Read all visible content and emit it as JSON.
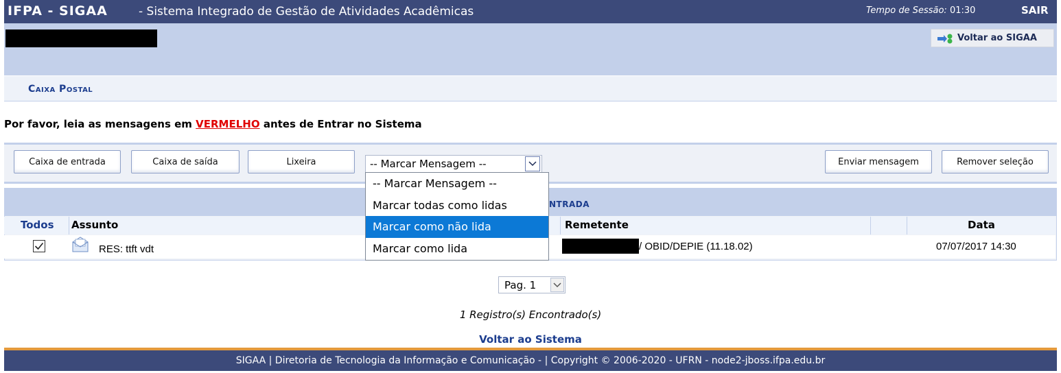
{
  "header": {
    "brand": "IFPA - SIGAA",
    "system_title": "- Sistema Integrado de Gestão de Atividades Acadêmicas",
    "session_label": "Tempo de Sessão:",
    "session_time": "01:30",
    "logout": "SAIR"
  },
  "user_bar": {
    "back_label": "Voltar ao SIGAA"
  },
  "page": {
    "title": "Caixa Postal",
    "warning_before": "Por favor, leia as mensagens em ",
    "warning_red": "VERMELHO",
    "warning_after": " antes de Entrar no Sistema"
  },
  "toolbar": {
    "inbox": "Caixa de entrada",
    "outbox": "Caixa de saída",
    "trash": "Lixeira",
    "mark_select_value": "-- Marcar Mensagem --",
    "send": "Enviar mensagem",
    "remove": "Remover seleção"
  },
  "mark_dropdown": {
    "options": [
      "-- Marcar Mensagem --",
      "Marcar todas como lidas",
      "Marcar como não lida",
      "Marcar como lida"
    ],
    "highlighted_index": 2
  },
  "table": {
    "caption_visible": "NTRADA",
    "headers": {
      "all": "Todos",
      "subject": "Assunto",
      "sender": "Remetente",
      "date": "Data"
    },
    "rows": [
      {
        "checked": true,
        "subject": "RES: ttft vdt",
        "sender_suffix": "/ OBID/DEPIE (11.18.02)",
        "date": "07/07/2017 14:30"
      }
    ]
  },
  "pagination": {
    "value": "Pag. 1"
  },
  "records": "1 Registro(s) Encontrado(s)",
  "back_system": "Voltar ao Sistema",
  "footer": "SIGAA | Diretoria de Tecnologia da Informação e Comunicação - | Copyright © 2006-2020 - UFRN - node2-jboss.ifpa.edu.br",
  "colors": {
    "header_bg": "#3c4a7a",
    "panel": "#c3d0ea",
    "accent_orange": "#e49a3c",
    "highlight": "#0c79d6",
    "warning_red": "#e00000"
  }
}
